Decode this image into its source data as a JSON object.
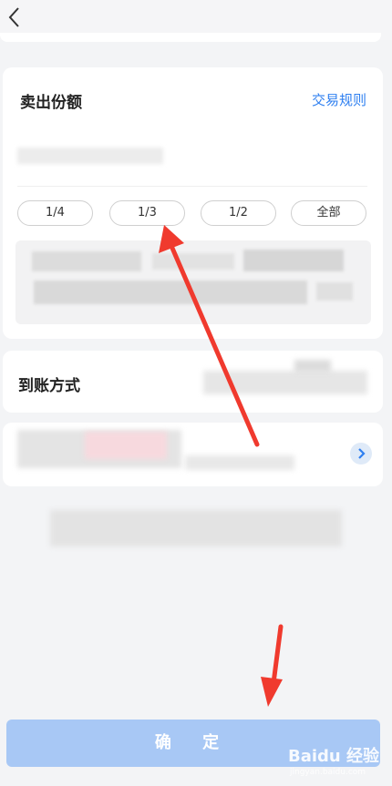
{
  "header": {
    "back_icon": "chevron-left-icon"
  },
  "sell": {
    "title": "卖出份额",
    "rules_link": "交易规则",
    "chips": [
      "1/4",
      "1/3",
      "1/2",
      "全部"
    ]
  },
  "method": {
    "title": "到账方式"
  },
  "bank": {
    "chevron_icon": "chevron-right-icon"
  },
  "confirm_button": "确 定",
  "watermark": {
    "brand": "Baidu 经验",
    "url": "jingyan.baidu.com"
  },
  "colors": {
    "accent": "#2e7ff0",
    "confirm_bg": "#a8c8f5",
    "arrow": "#f03a2e",
    "background": "#f3f4f6"
  }
}
